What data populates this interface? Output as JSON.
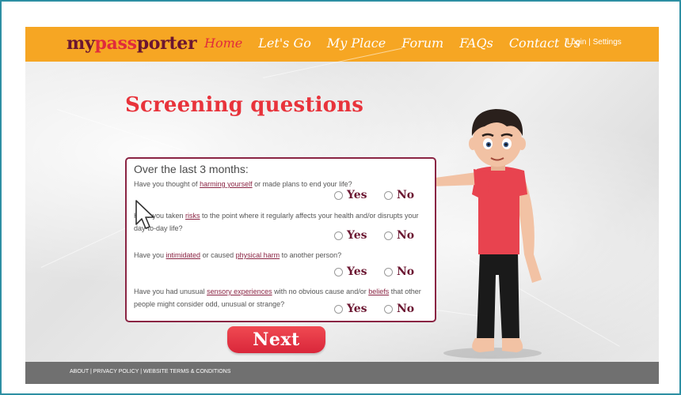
{
  "header": {
    "logo": {
      "part1": "my",
      "part2": "pass",
      "part3": "porter"
    },
    "nav": [
      {
        "label": "Home",
        "active": true
      },
      {
        "label": "Let's Go",
        "active": false
      },
      {
        "label": "My Place",
        "active": false
      },
      {
        "label": "Forum",
        "active": false
      },
      {
        "label": "FAQs",
        "active": false
      },
      {
        "label": "Contact Us",
        "active": false
      }
    ],
    "login_label": "Login",
    "separator": " | ",
    "settings_label": "Settings"
  },
  "main": {
    "title": "Screening questions",
    "card_heading": "Over the last 3 months:",
    "yes_label": "Yes",
    "no_label": "No",
    "questions": [
      {
        "parts": [
          "Have you thought of ",
          "harming yourself",
          " or made plans to end your life?"
        ]
      },
      {
        "parts": [
          "Have you taken ",
          "risks",
          " to the point where it regularly affects your health and/or disrupts your day-to-day life?"
        ]
      },
      {
        "parts": [
          "Have you ",
          "intimidated",
          " or caused ",
          "physical harm",
          " to another person?"
        ]
      },
      {
        "parts": [
          "Have you had unusual ",
          "sensory experiences",
          " with no obvious cause and/or ",
          "beliefs",
          " that other people might consider odd, unusual or strange?"
        ]
      }
    ],
    "next_label": "Next"
  },
  "footer": {
    "about": "ABOUT",
    "privacy": "PRIVACY POLICY",
    "terms": "WEBSITE TERMS & CONDITIONS",
    "separator": " | "
  },
  "colors": {
    "nav_bg": "#f6a623",
    "brand_dark": "#6b1631",
    "brand_red": "#e02b3c",
    "title_red": "#e8333b",
    "card_border": "#8a2443",
    "footer_bg": "#707070",
    "frame_border": "#2d8fa3"
  },
  "icons": {
    "cursor": "mouse-pointer-icon",
    "radio": "radio-circle-icon"
  }
}
